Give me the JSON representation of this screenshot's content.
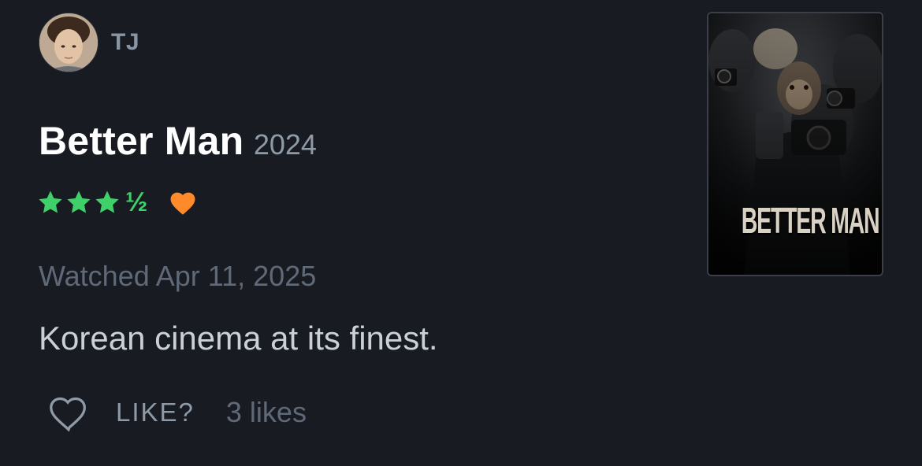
{
  "author": {
    "name": "TJ"
  },
  "film": {
    "title": "Better Man",
    "year": "2024",
    "poster_title": "BETTER MAN"
  },
  "rating": {
    "stars": 3.5,
    "half_symbol": "½",
    "liked": true,
    "star_color": "#3fd06a",
    "heart_color": "#ff8a2a"
  },
  "watched_text": "Watched Apr 11, 2025",
  "review_text": "Korean cinema at its finest.",
  "actions": {
    "like_label": "LIKE?",
    "likes_count": "3 likes"
  },
  "colors": {
    "background": "#181b21",
    "muted": "#5f6977"
  }
}
